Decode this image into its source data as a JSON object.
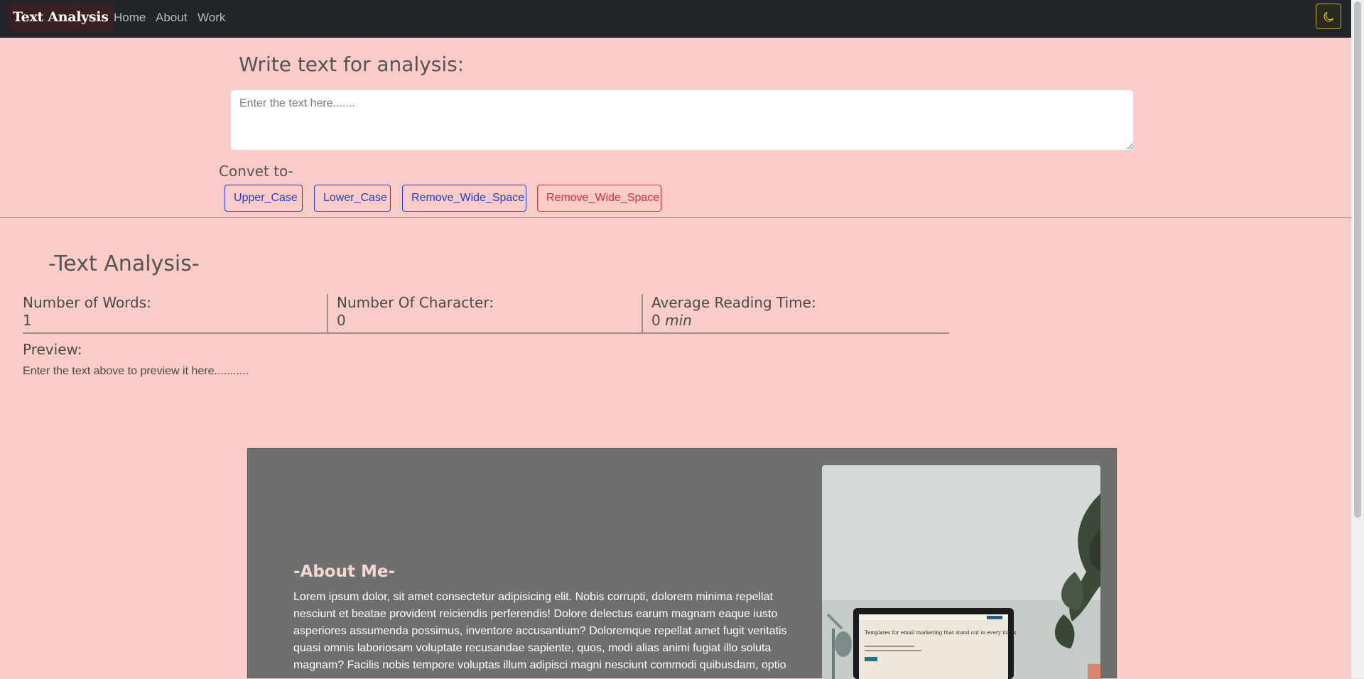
{
  "navbar": {
    "brand": "Text Analysis",
    "links": [
      "Home",
      "About",
      "Work"
    ],
    "theme_icon": "moon-icon",
    "background": "#212529",
    "toggle_color": "#e8c032"
  },
  "input_section": {
    "heading": "Write text for analysis:",
    "placeholder": "Enter the text here.......",
    "value": "",
    "convert_label": "Convet to-",
    "buttons": [
      {
        "label": "Upper_Case",
        "color": "#1f3fd6"
      },
      {
        "label": "Lower_Case",
        "color": "#1f3fd6"
      },
      {
        "label": "Remove_Wide_Space",
        "color": "#1f3fd6"
      },
      {
        "label": "Remove_Wide_Space",
        "color": "#d22d3d"
      }
    ]
  },
  "analysis": {
    "heading": "-Text Analysis-",
    "stats": [
      {
        "label": "Number of Words:",
        "value": "1",
        "unit": ""
      },
      {
        "label": "Number Of Character:",
        "value": "0",
        "unit": ""
      },
      {
        "label": "Average Reading Time:",
        "value": "0",
        "unit": "min"
      }
    ],
    "preview_label": "Preview:",
    "preview_text": "Enter the text above to preview it here..........."
  },
  "about": {
    "title": "-About Me-",
    "body": "Lorem ipsum dolor, sit amet consectetur adipisicing elit. Nobis corrupti, dolorem minima repellat nesciunt et beatae provident reiciendis perferendis! Dolore delectus earum magnam eaque iusto asperiores assumenda possimus, inventore accusantium? Doloremque repellat amet fugit veritatis quasi omnis laboriosam voluptate recusandae sapiente, quos, modi alias animi fugiat illo soluta magnam? Facilis nobis tempore voluptas illum adipisci magni nesciunt commodi quibusdam, optio",
    "laptop_screen_text": "Templates for email marketing that stand out in every inbox"
  },
  "colors": {
    "page_background": "#f9ccc7",
    "card_background": "#6f6f6d",
    "about_title": "#f5d7d3"
  }
}
